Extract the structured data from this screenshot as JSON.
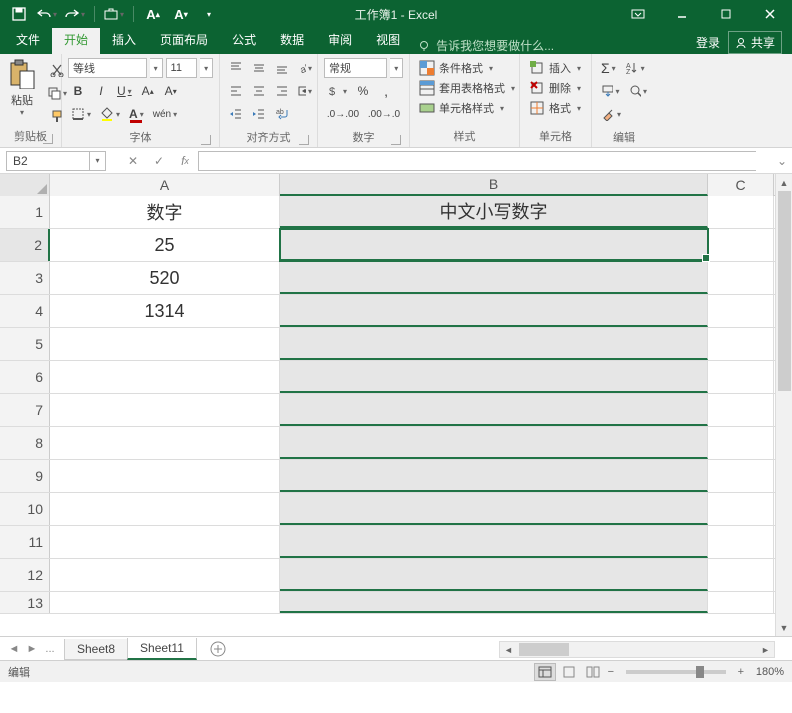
{
  "title": "工作簿1 - Excel",
  "tabs": {
    "file": "文件",
    "home": "开始",
    "insert": "插入",
    "layout": "页面布局",
    "formulas": "公式",
    "data": "数据",
    "review": "审阅",
    "view": "视图",
    "tell": "告诉我您想要做什么...",
    "login": "登录",
    "share": "共享"
  },
  "ribbon": {
    "clipboard": {
      "paste": "粘贴",
      "label": "剪贴板"
    },
    "font": {
      "name": "等线",
      "size": "11",
      "label": "字体"
    },
    "align": {
      "label": "对齐方式"
    },
    "number": {
      "format": "常规",
      "label": "数字"
    },
    "styles": {
      "cond": "条件格式",
      "table": "套用表格格式",
      "cell": "单元格样式",
      "label": "样式"
    },
    "cells": {
      "insert": "插入",
      "delete": "删除",
      "format": "格式",
      "label": "单元格"
    },
    "editing": {
      "label": "编辑"
    }
  },
  "namebox": "B2",
  "columns": [
    "A",
    "B",
    "C"
  ],
  "rows": {
    "headers": [
      "1",
      "2",
      "3",
      "4",
      "5",
      "6",
      "7",
      "8",
      "9",
      "10",
      "11",
      "12",
      "13"
    ],
    "data": {
      "A1": "数字",
      "B1": "中文小写数字",
      "A2": "25",
      "A3": "520",
      "A4": "1314"
    }
  },
  "sheets": {
    "prev": "Sheet8",
    "active": "Sheet11",
    "ellipsis": "..."
  },
  "status": {
    "mode": "编辑",
    "zoom": "180%"
  }
}
